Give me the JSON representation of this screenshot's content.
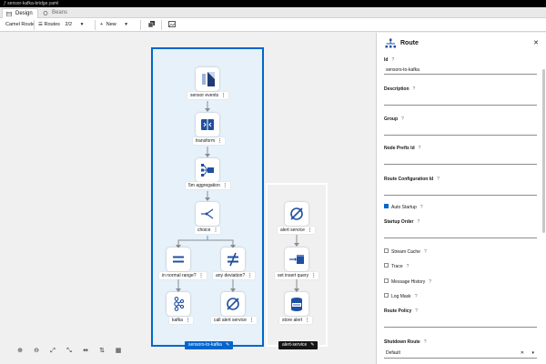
{
  "window": {
    "filename": "sensor-kafka-bridge.yaml"
  },
  "tabs": [
    {
      "label": "Design",
      "active": true
    },
    {
      "label": "Beans",
      "active": false
    }
  ],
  "toolbar": {
    "camel_route": "Camel Route",
    "routes_label": "Routes",
    "routes_count": "2/2",
    "new_label": "New"
  },
  "canvas": {
    "routes": [
      {
        "name": "sensors-to-kafka",
        "nodes": [
          {
            "label": "sensor events",
            "icon": "sensor-events-icon"
          },
          {
            "label": "transform",
            "icon": "transform-icon"
          },
          {
            "label": "5m aggregation",
            "icon": "aggregation-icon"
          },
          {
            "label": "choice",
            "icon": "choice-icon"
          },
          {
            "label": "in normal range?",
            "icon": "equals-icon"
          },
          {
            "label": "any deviation?",
            "icon": "not-equal-icon"
          },
          {
            "label": "kafka",
            "icon": "kafka-icon"
          },
          {
            "label": "call alert service",
            "icon": "direct-icon"
          }
        ]
      },
      {
        "name": "alert-service",
        "nodes": [
          {
            "label": "alert service",
            "icon": "direct-icon"
          },
          {
            "label": "set insert query",
            "icon": "set-body-icon"
          },
          {
            "label": "store alert",
            "icon": "jdbc-icon"
          }
        ]
      }
    ],
    "colors": {
      "selected": "#0066cc",
      "dark": "#151515"
    }
  },
  "panel": {
    "title": "Route",
    "fields": {
      "id_label": "Id",
      "id_value": "sensors-to-kafka",
      "description_label": "Description",
      "group_label": "Group",
      "node_prefix_label": "Node Prefix Id",
      "route_config_label": "Route Configuration Id",
      "auto_startup_label": "Auto Startup",
      "startup_order_label": "Startup Order",
      "stream_cache_label": "Stream Cache",
      "trace_label": "Trace",
      "message_history_label": "Message History",
      "log_mask_label": "Log Mask",
      "route_policy_label": "Route Policy",
      "shutdown_route_label": "Shutdown Route",
      "shutdown_route_value": "Default"
    },
    "auto_startup_checked": true
  }
}
